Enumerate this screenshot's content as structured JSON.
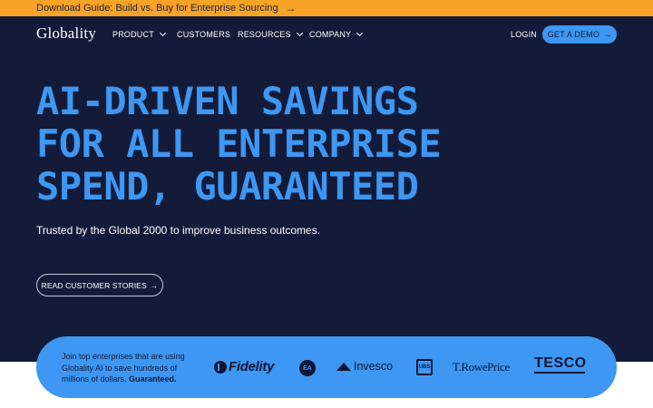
{
  "banner": {
    "text": "Download Guide: Build vs. Buy for Enterprise Sourcing",
    "arrow": "→"
  },
  "nav": {
    "logo": "Globality",
    "items": [
      {
        "label": "PRODUCT",
        "has_dropdown": true
      },
      {
        "label": "CUSTOMERS",
        "has_dropdown": false
      },
      {
        "label": "RESOURCES",
        "has_dropdown": true
      },
      {
        "label": "COMPANY",
        "has_dropdown": true
      }
    ],
    "login": "LOGIN",
    "demo_button": "GET A DEMO",
    "demo_arrow": "→"
  },
  "hero": {
    "headline_lines": [
      "AI-DRIVEN SAVINGS",
      "FOR ALL ENTERPRISE",
      "SPEND, GUARANTEED"
    ],
    "subtitle": "Trusted by the Global 2000 to improve business outcomes.",
    "cta": "READ CUSTOMER STORIES",
    "cta_arrow": "→"
  },
  "logo_band": {
    "text": "Join top enterprises that are using Globality AI to save hundreds of millions of dollars.",
    "emphasis": "Guaranteed.",
    "brands": {
      "fidelity": "Fidelity",
      "ea": "EA",
      "invesco": "Invesco",
      "ubs": "UBS",
      "trowe": "T.RowePrice",
      "tesco": "TESCO"
    }
  },
  "colors": {
    "banner_bg": "#f6a327",
    "hero_bg": "#131b38",
    "accent_blue": "#3d97f3"
  }
}
